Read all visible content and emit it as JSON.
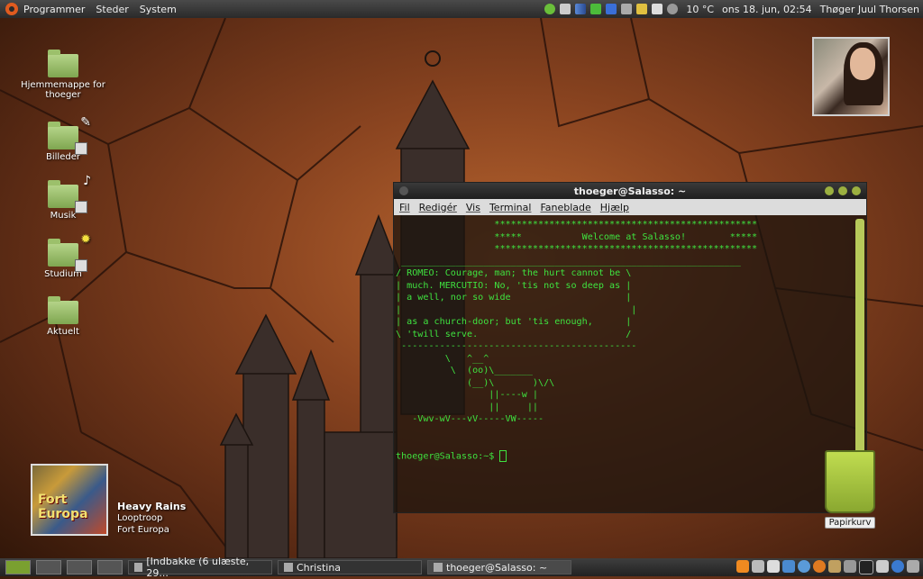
{
  "top_panel": {
    "menus": [
      "Programmer",
      "Steder",
      "System"
    ],
    "temperature": "10 °C",
    "datetime": "ons 18. jun, 02:54",
    "user": "Thøger Juul Thorsen"
  },
  "desktop": {
    "icons": [
      "Hjemmemappe for thoeger",
      "Billeder",
      "Musik",
      "Studium",
      "Aktuelt"
    ],
    "trash_label": "Papirkurv"
  },
  "music": {
    "cover_text": "Fort Europa",
    "title": "Heavy Rains",
    "artist": "Looptroop",
    "album": "Fort Europa"
  },
  "terminal": {
    "title": "thoeger@Salasso: ~",
    "menus": [
      "Fil",
      "Redigér",
      "Vis",
      "Terminal",
      "Faneblade",
      "Hjælp"
    ],
    "lines": [
      "                  ************************************************",
      "                  *****           Welcome at Salasso!        *****",
      "                  ************************************************",
      " ______________________________________________________________",
      "/ ROMEO: Courage, man; the hurt cannot be \\",
      "| much. MERCUTIO: No, 'tis not so deep as |",
      "| a well, nor so wide                     |",
      "|                                          |",
      "| as a church-door; but 'tis enough,      |",
      "\\ 'twill serve.                           /",
      " -------------------------------------------",
      "         \\   ^__^",
      "          \\  (oo)\\_______",
      "             (__)\\       )\\/\\",
      "                 ||----w |",
      "                 ||     ||",
      "   -Vwv-wV---vV-----VW-----",
      "",
      ""
    ],
    "prompt": "thoeger@Salasso:~$ "
  },
  "taskbar": {
    "tasks": [
      "[Indbakke (6 ulæste, 29...",
      "Christina",
      "thoeger@Salasso: ~"
    ]
  },
  "colors": {
    "terminal_text": "#3fe23f",
    "accent_green": "#9bb040",
    "ubuntu_orange": "#e05b1f"
  }
}
